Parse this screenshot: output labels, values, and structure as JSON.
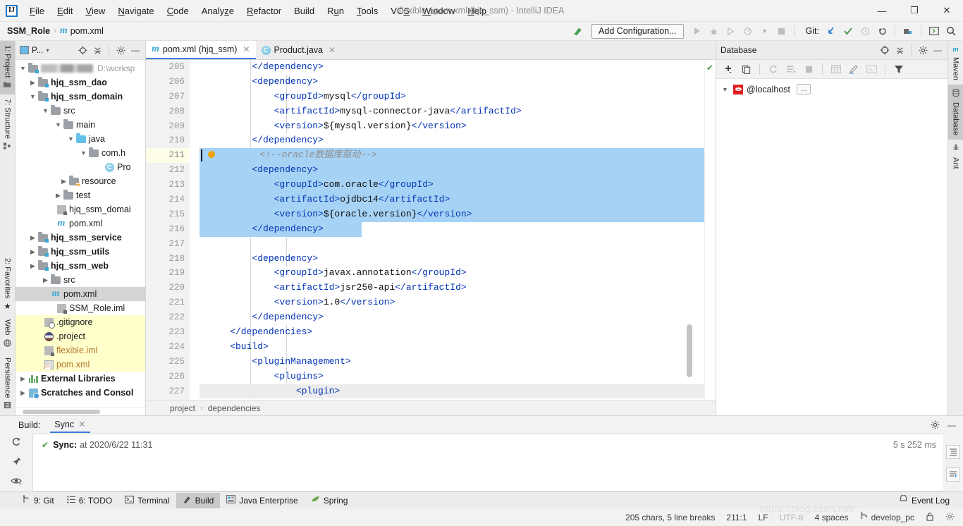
{
  "window": {
    "title": "flexible - pom.xml (hjq_ssm) - IntelliJ IDEA",
    "logo": "IJ",
    "minimize": "—",
    "restore": "❐",
    "close": "✕"
  },
  "menu": [
    {
      "label": "File"
    },
    {
      "label": "Edit"
    },
    {
      "label": "View"
    },
    {
      "label": "Navigate"
    },
    {
      "label": "Code"
    },
    {
      "label": "Analyze"
    },
    {
      "label": "Refactor"
    },
    {
      "label": "Build"
    },
    {
      "label": "Run"
    },
    {
      "label": "Tools"
    },
    {
      "label": "VCS"
    },
    {
      "label": "Window"
    },
    {
      "label": "Help"
    }
  ],
  "navbar": {
    "project": "SSM_Role",
    "separator": "›",
    "file": "pom.xml",
    "maven_glyph": "m",
    "add_configuration": "Add Configuration...",
    "git_label": "Git:",
    "icons": {
      "build_hammer": "↖",
      "run": "▶",
      "debug": "🐞",
      "run_coverage": "▷",
      "profile": "◔",
      "dropdown": "▾",
      "stop": "■",
      "update_project": "↙",
      "commit": "✔",
      "history": "◷",
      "rollback": "↺",
      "project_structure": "▤",
      "terminal": "▣",
      "search_everywhere": "⌕"
    }
  },
  "left_rail": [
    {
      "label": "1: Project",
      "selected": true,
      "icon": "folder-icon"
    },
    {
      "label": "7: Structure",
      "selected": false,
      "icon": "structure-icon"
    },
    {
      "label": "2: Favorites",
      "selected": false,
      "icon": "star-icon"
    },
    {
      "label": "Web",
      "selected": false,
      "icon": "web-icon"
    },
    {
      "label": "Persistence",
      "selected": false,
      "icon": "persistence-icon"
    }
  ],
  "right_rail": [
    {
      "label": "Maven",
      "selected": false,
      "icon": "maven-icon"
    },
    {
      "label": "Database",
      "selected": true,
      "icon": "database-icon"
    },
    {
      "label": "Ant",
      "selected": false,
      "icon": "ant-icon"
    }
  ],
  "project_panel": {
    "title": "P...",
    "actions": {
      "collapse": "⨷",
      "expand": "☰",
      "settings": "⚙",
      "hide": "—"
    },
    "tree": [
      {
        "label": "",
        "path": "D:\\worksp",
        "depth": 0,
        "arrow": "▼",
        "icon": "module-root",
        "style": "blurred"
      },
      {
        "label": "hjq_ssm_dao",
        "depth": 1,
        "arrow": "▶",
        "icon": "module",
        "style": "bold"
      },
      {
        "label": "hjq_ssm_domain",
        "depth": 1,
        "arrow": "▼",
        "icon": "module",
        "style": "bold"
      },
      {
        "label": "src",
        "depth": 2,
        "arrow": "▼",
        "icon": "folder",
        "style": "plain"
      },
      {
        "label": "main",
        "depth": 3,
        "arrow": "▼",
        "icon": "folder",
        "style": "plain"
      },
      {
        "label": "java",
        "depth": 4,
        "arrow": "▼",
        "icon": "source-folder",
        "style": "plain"
      },
      {
        "label": "com.h",
        "depth": 5,
        "arrow": "▼",
        "icon": "package",
        "style": "plain"
      },
      {
        "label": "Pro",
        "depth": 6,
        "arrow": "",
        "icon": "class",
        "style": "plain"
      },
      {
        "label": "resource",
        "depth": 4,
        "arrow": "▶",
        "icon": "resource-folder",
        "style": "plain"
      },
      {
        "label": "test",
        "depth": 3,
        "arrow": "▶",
        "icon": "folder",
        "style": "plain"
      },
      {
        "label": "hjq_ssm_domai",
        "depth": 3,
        "arrow": "",
        "icon": "iml",
        "style": "plain"
      },
      {
        "label": "pom.xml",
        "depth": 3,
        "arrow": "",
        "icon": "maven-pom",
        "style": "plain"
      },
      {
        "label": "hjq_ssm_service",
        "depth": 1,
        "arrow": "▶",
        "icon": "module",
        "style": "bold"
      },
      {
        "label": "hjq_ssm_utils",
        "depth": 1,
        "arrow": "▶",
        "icon": "module",
        "style": "bold"
      },
      {
        "label": "hjq_ssm_web",
        "depth": 1,
        "arrow": "▶",
        "icon": "module",
        "style": "bold"
      },
      {
        "label": "src",
        "depth": 2,
        "arrow": "▶",
        "icon": "folder",
        "style": "plain"
      },
      {
        "label": "pom.xml",
        "depth": 2,
        "arrow": "",
        "icon": "maven-pom",
        "style": "selected"
      },
      {
        "label": "SSM_Role.iml",
        "depth": 2,
        "arrow": "",
        "icon": "iml",
        "style": "plain"
      },
      {
        "label": ".gitignore",
        "depth": 1,
        "arrow": "",
        "icon": "gitignore",
        "style": "highlight"
      },
      {
        "label": ".project",
        "depth": 1,
        "arrow": "",
        "icon": "project-file",
        "style": "highlight"
      },
      {
        "label": "flexible.iml",
        "depth": 1,
        "arrow": "",
        "icon": "iml",
        "style": "highlight-orange"
      },
      {
        "label": "pom.xml",
        "depth": 1,
        "arrow": "",
        "icon": "pom-xml",
        "style": "highlight-orange"
      },
      {
        "label": "External Libraries",
        "depth": 0,
        "arrow": "▶",
        "icon": "libraries",
        "style": "bold"
      },
      {
        "label": "Scratches and Consol",
        "depth": 0,
        "arrow": "▶",
        "icon": "scratches",
        "style": "bold"
      }
    ]
  },
  "editor": {
    "tabs": [
      {
        "label": "pom.xml (hjq_ssm)",
        "icon": "maven-file-icon",
        "active": true,
        "close": "✕"
      },
      {
        "label": "Product.java",
        "icon": "java-class-icon",
        "active": false,
        "close": "✕"
      }
    ],
    "first_line_number": 205,
    "lines": [
      {
        "num": 205,
        "fold": "⊖",
        "indent": 2,
        "selected": false,
        "segments": [
          {
            "t": "tag",
            "v": "        </dependency>"
          }
        ]
      },
      {
        "num": 206,
        "fold": "⊟",
        "indent": 2,
        "selected": false,
        "segments": [
          {
            "t": "tag",
            "v": "        <dependency>"
          }
        ]
      },
      {
        "num": 207,
        "fold": "",
        "indent": 3,
        "selected": false,
        "segments": [
          {
            "t": "tag",
            "v": "            <groupId>"
          },
          {
            "t": "txt",
            "v": "mysql"
          },
          {
            "t": "tag",
            "v": "</groupId>"
          }
        ]
      },
      {
        "num": 208,
        "fold": "",
        "indent": 3,
        "selected": false,
        "segments": [
          {
            "t": "tag",
            "v": "            <artifactId>"
          },
          {
            "t": "txt",
            "v": "mysql-connector-java"
          },
          {
            "t": "tag",
            "v": "</artifactId>"
          }
        ]
      },
      {
        "num": 209,
        "fold": "",
        "indent": 3,
        "selected": false,
        "segments": [
          {
            "t": "tag",
            "v": "            <version>"
          },
          {
            "t": "txt",
            "v": "${mysql.version}"
          },
          {
            "t": "tag",
            "v": "</version>"
          }
        ]
      },
      {
        "num": 210,
        "fold": "⊖",
        "indent": 2,
        "selected": false,
        "segments": [
          {
            "t": "tag",
            "v": "        </dependency>"
          }
        ]
      },
      {
        "num": 211,
        "fold": "",
        "indent": 2,
        "selected": true,
        "caret": true,
        "bulb": true,
        "current": true,
        "segments": [
          {
            "t": "cmt",
            "v": "        <!--oracle数据库驱动-->"
          }
        ]
      },
      {
        "num": 212,
        "fold": "⊟",
        "indent": 2,
        "selected": true,
        "segments": [
          {
            "t": "tag",
            "v": "        <dependency>"
          }
        ]
      },
      {
        "num": 213,
        "fold": "",
        "indent": 3,
        "selected": true,
        "segments": [
          {
            "t": "tag",
            "v": "            <groupId>"
          },
          {
            "t": "txt",
            "v": "com.oracle"
          },
          {
            "t": "tag",
            "v": "</groupId>"
          }
        ]
      },
      {
        "num": 214,
        "fold": "",
        "indent": 3,
        "selected": true,
        "segments": [
          {
            "t": "tag",
            "v": "            <artifactId>"
          },
          {
            "t": "txt",
            "v": "ojdbc14"
          },
          {
            "t": "tag",
            "v": "</artifactId>"
          }
        ]
      },
      {
        "num": 215,
        "fold": "",
        "indent": 3,
        "selected": true,
        "segments": [
          {
            "t": "tag",
            "v": "            <version>"
          },
          {
            "t": "txt",
            "v": "${oracle.version}"
          },
          {
            "t": "tag",
            "v": "</version>"
          }
        ]
      },
      {
        "num": 216,
        "fold": "⊖",
        "indent": 2,
        "selected": true,
        "segments": [
          {
            "t": "tag",
            "v": "        </dependency>"
          }
        ]
      },
      {
        "num": 217,
        "fold": "",
        "indent": 2,
        "selected": false,
        "segments": [
          {
            "t": "txt",
            "v": ""
          }
        ]
      },
      {
        "num": 218,
        "fold": "⊟",
        "indent": 2,
        "selected": false,
        "segments": [
          {
            "t": "tag",
            "v": "        <dependency>"
          }
        ]
      },
      {
        "num": 219,
        "fold": "",
        "indent": 3,
        "selected": false,
        "segments": [
          {
            "t": "tag",
            "v": "            <groupId>"
          },
          {
            "t": "txt",
            "v": "javax.annotation"
          },
          {
            "t": "tag",
            "v": "</groupId>"
          }
        ]
      },
      {
        "num": 220,
        "fold": "",
        "indent": 3,
        "selected": false,
        "segments": [
          {
            "t": "tag",
            "v": "            <artifactId>"
          },
          {
            "t": "txt",
            "v": "jsr250-api"
          },
          {
            "t": "tag",
            "v": "</artifactId>"
          }
        ]
      },
      {
        "num": 221,
        "fold": "",
        "indent": 3,
        "selected": false,
        "segments": [
          {
            "t": "tag",
            "v": "            <version>"
          },
          {
            "t": "txt",
            "v": "1.0"
          },
          {
            "t": "tag",
            "v": "</version>"
          }
        ]
      },
      {
        "num": 222,
        "fold": "⊖",
        "indent": 2,
        "selected": false,
        "segments": [
          {
            "t": "tag",
            "v": "        </dependency>"
          }
        ]
      },
      {
        "num": 223,
        "fold": "⊖",
        "indent": 1,
        "selected": false,
        "segments": [
          {
            "t": "tag",
            "v": "    </dependencies>"
          }
        ]
      },
      {
        "num": 224,
        "fold": "⊟",
        "indent": 1,
        "selected": false,
        "segments": [
          {
            "t": "tag",
            "v": "    <build>"
          }
        ]
      },
      {
        "num": 225,
        "fold": "⊟",
        "indent": 2,
        "selected": false,
        "segments": [
          {
            "t": "tag",
            "v": "        <pluginManagement>"
          }
        ]
      },
      {
        "num": 226,
        "fold": "⊟",
        "indent": 3,
        "selected": false,
        "segments": [
          {
            "t": "tag",
            "v": "            <plugins>"
          }
        ]
      },
      {
        "num": 227,
        "fold": "⊟",
        "indent": 4,
        "selected": false,
        "dimmed": true,
        "segments": [
          {
            "t": "tag",
            "v": "                <plugin>"
          }
        ]
      }
    ],
    "breadcrumb": [
      {
        "label": "project"
      },
      {
        "label": "dependencies"
      }
    ],
    "inspection_ok": "✔"
  },
  "database_panel": {
    "title": "Database",
    "header_actions": {
      "add_scope": "⊕",
      "collapse": "⨷",
      "settings": "⚙",
      "hide": "—"
    },
    "toolbar": [
      {
        "name": "new",
        "glyph": "＋",
        "enabled": true
      },
      {
        "name": "duplicate",
        "glyph": "❐",
        "enabled": true
      },
      {
        "name": "refresh",
        "glyph": "⟳",
        "enabled": false
      },
      {
        "name": "synchronize",
        "glyph": "☲",
        "enabled": false
      },
      {
        "name": "stop",
        "glyph": "■",
        "enabled": false
      },
      {
        "name": "table-editor",
        "glyph": "▦",
        "enabled": false
      },
      {
        "name": "modify",
        "glyph": "✎",
        "enabled": false
      },
      {
        "name": "query-console",
        "glyph": "QL",
        "enabled": false
      },
      {
        "name": "filter",
        "glyph": "▼",
        "enabled": true
      }
    ],
    "tree": [
      {
        "label": "@localhost",
        "arrow": "▼",
        "icon": "oracle-icon",
        "badge": "..."
      }
    ]
  },
  "build_panel": {
    "title": "Build:",
    "tab": "Sync",
    "tab_close": "✕",
    "settings": "⚙",
    "hide": "—",
    "rows": [
      {
        "status": "✔",
        "label": "Sync:",
        "detail": "at 2020/6/22 11:31",
        "duration": "5 s 252 ms"
      }
    ],
    "side_actions": [
      {
        "name": "rerun",
        "glyph": "⟳"
      },
      {
        "name": "pin",
        "glyph": "⚑"
      },
      {
        "name": "toggle-view",
        "glyph": "◉"
      }
    ],
    "right_actions": [
      {
        "name": "expand-all",
        "glyph": "≡"
      },
      {
        "name": "scroll-to-end",
        "glyph": "↧"
      }
    ]
  },
  "toolwindow_bar": [
    {
      "label": "9: Git",
      "icon": "git-icon",
      "selected": false
    },
    {
      "label": "6: TODO",
      "icon": "todo-icon",
      "selected": false
    },
    {
      "label": "Terminal",
      "icon": "terminal-icon",
      "selected": false
    },
    {
      "label": "Build",
      "icon": "build-icon",
      "selected": true
    },
    {
      "label": "Java Enterprise",
      "icon": "java-enterprise-icon",
      "selected": false
    },
    {
      "label": "Spring",
      "icon": "spring-icon",
      "selected": false
    }
  ],
  "event_log": {
    "label": "Event Log",
    "icon": "event-log-icon"
  },
  "status_bar": {
    "chars": "205 chars, 5 line breaks",
    "caret": "211:1",
    "line_separator": "LF",
    "encoding": "UTF-8",
    "indent": "4 spaces",
    "branch": "develop_pc",
    "branch_icon": "⎇",
    "lock_icon": "🔓",
    "inspection_icon": "⚙"
  },
  "watermark": "https://blog.csdn.net/...",
  "colors": {
    "selection_blue": "#a6d2f5",
    "xml_tag": "#0033b3",
    "comment_gray": "#8c8c8c",
    "tab_underline": "#3b7ddd",
    "highlight_yellow": "#ffffcc",
    "oracle_red": "#e02020",
    "success_green": "#4a9b4a"
  }
}
